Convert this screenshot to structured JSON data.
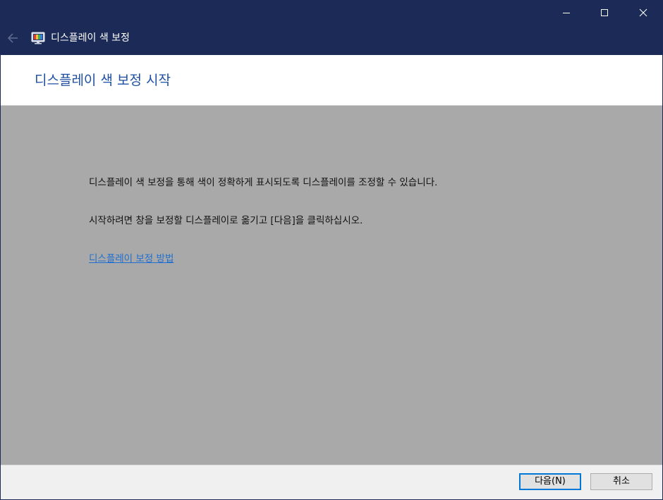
{
  "window": {
    "title": "디스플레이 색 보정",
    "controls": {
      "minimize_icon": "minimize-icon",
      "maximize_icon": "maximize-icon",
      "close_icon": "close-icon"
    },
    "back_icon": "back-arrow-icon",
    "app_icon": "display-color-calibration-icon",
    "colors": {
      "titlebar_bg": "#1b2a56",
      "heading_text": "#1e4fa3",
      "content_bg": "#a9a9a9",
      "link": "#1f6fd0",
      "default_button_border": "#0078d7"
    }
  },
  "header": {
    "heading": "디스플레이 색 보정 시작"
  },
  "content": {
    "paragraph_1": "디스플레이 색 보정을 통해 색이 정확하게 표시되도록 디스플레이를 조정할 수 있습니다.",
    "paragraph_2": "시작하려면 창을 보정할 디스플레이로 옮기고 [다음]을 클릭하십시오.",
    "help_link": "디스플레이 보정 방법"
  },
  "footer": {
    "next_label": "다음(N)",
    "cancel_label": "취소"
  }
}
